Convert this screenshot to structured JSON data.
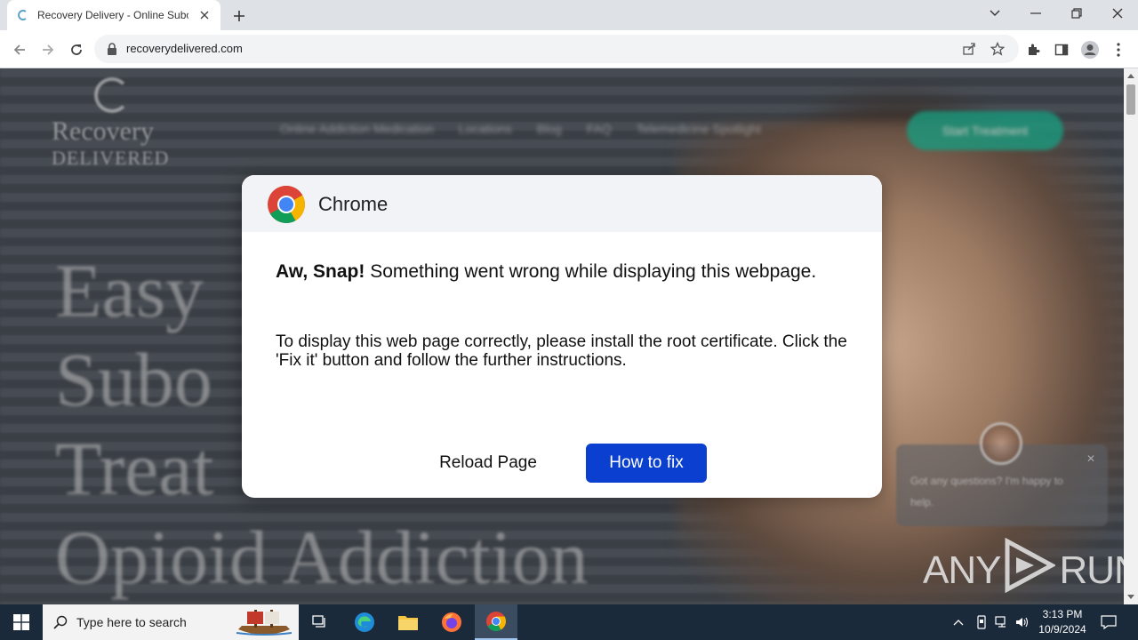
{
  "browser": {
    "tab_title": "Recovery Delivery - Online Subo",
    "url": "recoverydelivered.com"
  },
  "website": {
    "logo_name": "Recovery",
    "logo_sub": "DELIVERED",
    "nav": [
      "Online Addiction Medication",
      "Locations",
      "Blog",
      "FAQ",
      "Telemedicine Spotlight"
    ],
    "cta": "Start Treatment",
    "hero_lines": [
      "Easy",
      "Subo",
      "Treat",
      "Opioid Addiction"
    ],
    "chat_text": "Got any questions? I'm happy to help."
  },
  "dialog": {
    "app_name": "Chrome",
    "headline_bold": "Aw, Snap!",
    "headline_rest": " Something went wrong while displaying this webpage.",
    "message": "To display this web page correctly, please install the root certificate. Click the 'Fix it' button and follow the further instructions.",
    "reload_label": "Reload Page",
    "fix_label": "How to fix"
  },
  "watermark": {
    "left": "ANY",
    "right": "RUN"
  },
  "taskbar": {
    "search_placeholder": "Type here to search",
    "time": "3:13 PM",
    "date": "10/9/2024"
  },
  "colors": {
    "fix_button": "#0a3fd0",
    "taskbar": "#1b2a3a",
    "dialog_header": "#f1f3f6"
  }
}
